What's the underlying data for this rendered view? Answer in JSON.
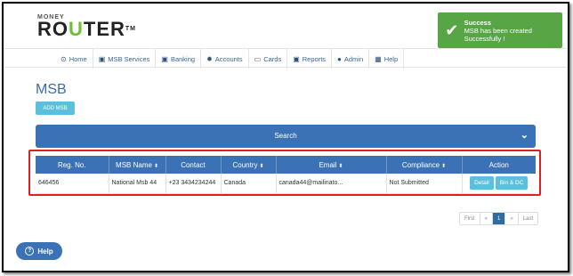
{
  "logo": {
    "top": "MONEY",
    "main_a": "RO",
    "main_u": "U",
    "main_b": "TER",
    "tm": "TM"
  },
  "toast": {
    "icon": "check-icon",
    "title": "Success",
    "message": "MSB has been created Successfully !",
    "color": "#57a545"
  },
  "nav": {
    "items": [
      {
        "label": "Home",
        "icon": "home-icon"
      },
      {
        "label": "MSB Services",
        "icon": "document-icon"
      },
      {
        "label": "Banking",
        "icon": "document-icon"
      },
      {
        "label": "Accounts",
        "icon": "gear-icon"
      },
      {
        "label": "Cards",
        "icon": "card-icon"
      },
      {
        "label": "Reports",
        "icon": "document-icon"
      },
      {
        "label": "Admin",
        "icon": "user-icon"
      },
      {
        "label": "Help",
        "icon": "grid-icon"
      }
    ]
  },
  "page": {
    "title": "MSB",
    "add_label": "ADD MSB"
  },
  "search": {
    "label": "Search"
  },
  "table": {
    "headers": [
      "Reg. No.",
      "MSB Name",
      "Contact",
      "Country",
      "Email",
      "Compliance",
      "Action"
    ],
    "rows": [
      {
        "reg": "646456",
        "name": "National Msb 44",
        "contact": "+23 3434234244",
        "country": "Canada",
        "email": "canada44@mailinato...",
        "compliance": "Not Submitted",
        "detail": "Detail",
        "bin": "Bin & DC"
      }
    ]
  },
  "pager": {
    "first": "First",
    "prev": "«",
    "page": "1",
    "next": "»",
    "last": "Last"
  },
  "help": {
    "label": "Help"
  },
  "colors": {
    "primary": "#3a72b5",
    "accent": "#5bc0de",
    "highlight": "#e02020"
  }
}
